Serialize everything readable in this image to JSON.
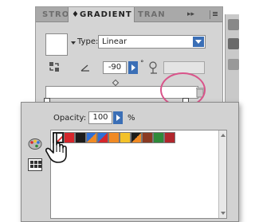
{
  "gradient_panel": {
    "tabs": {
      "stroke": "STRO",
      "gradient": "♦GRADIENT",
      "transparency": "TRAN",
      "collapse": "▸▸"
    },
    "type_label": "Type:",
    "type_value": "Linear",
    "angle_value": "-90",
    "angle_unit": "°"
  },
  "swatch_popup": {
    "opacity_label": "Opacity:",
    "opacity_value": "100",
    "opacity_unit": "%",
    "swatches": [
      {
        "name": "none",
        "color": "#ffffff"
      },
      {
        "name": "red",
        "color": "#d6262b"
      },
      {
        "name": "black",
        "color": "#1b1b1b"
      },
      {
        "name": "blue-orange",
        "color": "#2f6fd6",
        "color2": "#f08a24"
      },
      {
        "name": "blue-red",
        "color": "#2f6fd6",
        "color2": "#d6262b"
      },
      {
        "name": "orange",
        "color": "#f08a24"
      },
      {
        "name": "yellow",
        "color": "#f3c22a"
      },
      {
        "name": "black-orange",
        "color": "#1b1b1b",
        "color2": "#f08a24"
      },
      {
        "name": "brown",
        "color": "#8a3a22"
      },
      {
        "name": "green",
        "color": "#2e8a3a"
      },
      {
        "name": "dark-red",
        "color": "#b1262c"
      }
    ]
  },
  "colors": {
    "accent_blue": "#3b6fb6",
    "highlight_pink": "#d9548a",
    "panel_gray": "#d4d4d4"
  }
}
